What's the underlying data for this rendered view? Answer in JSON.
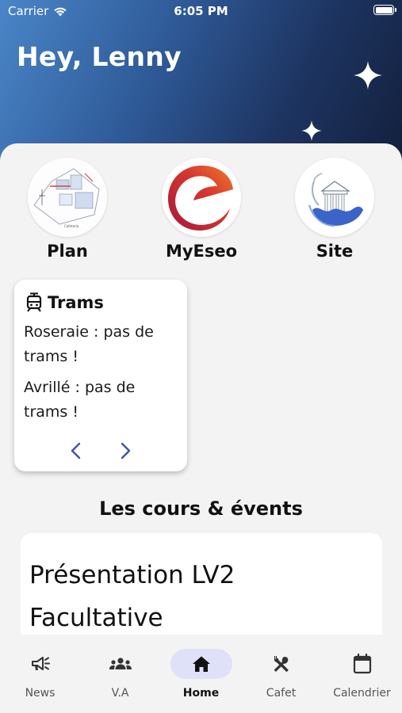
{
  "status_bar": {
    "carrier": "Carrier",
    "time": "6:05 PM"
  },
  "header": {
    "greeting": "Hey, Lenny"
  },
  "shortcuts": [
    {
      "label": "Plan",
      "icon": "campus-map-thumbnail"
    },
    {
      "label": "MyEseo",
      "icon": "myeseo-logo"
    },
    {
      "label": "Site",
      "icon": "eseo-site-logo"
    }
  ],
  "trams": {
    "title": "Trams",
    "icon": "tram-icon",
    "lines": [
      "Roseraie : pas de trams !",
      "Avrillé : pas de trams !"
    ]
  },
  "events": {
    "section_title": "Les cours & évents",
    "items": [
      {
        "title": "Présentation LV2 Facultative"
      }
    ]
  },
  "nav": {
    "items": [
      {
        "label": "News",
        "icon": "megaphone-icon"
      },
      {
        "label": "V.A",
        "icon": "people-group-icon"
      },
      {
        "label": "Home",
        "icon": "home-icon",
        "active": true
      },
      {
        "label": "Cafet",
        "icon": "utensils-icon"
      },
      {
        "label": "Calendrier",
        "icon": "calendar-icon"
      }
    ]
  },
  "colors": {
    "accent": "#3f51b5",
    "nav_active_bg": "#dfe1f8",
    "hero_gradient_start": "#4a86c8",
    "hero_gradient_end": "#131f3b"
  }
}
